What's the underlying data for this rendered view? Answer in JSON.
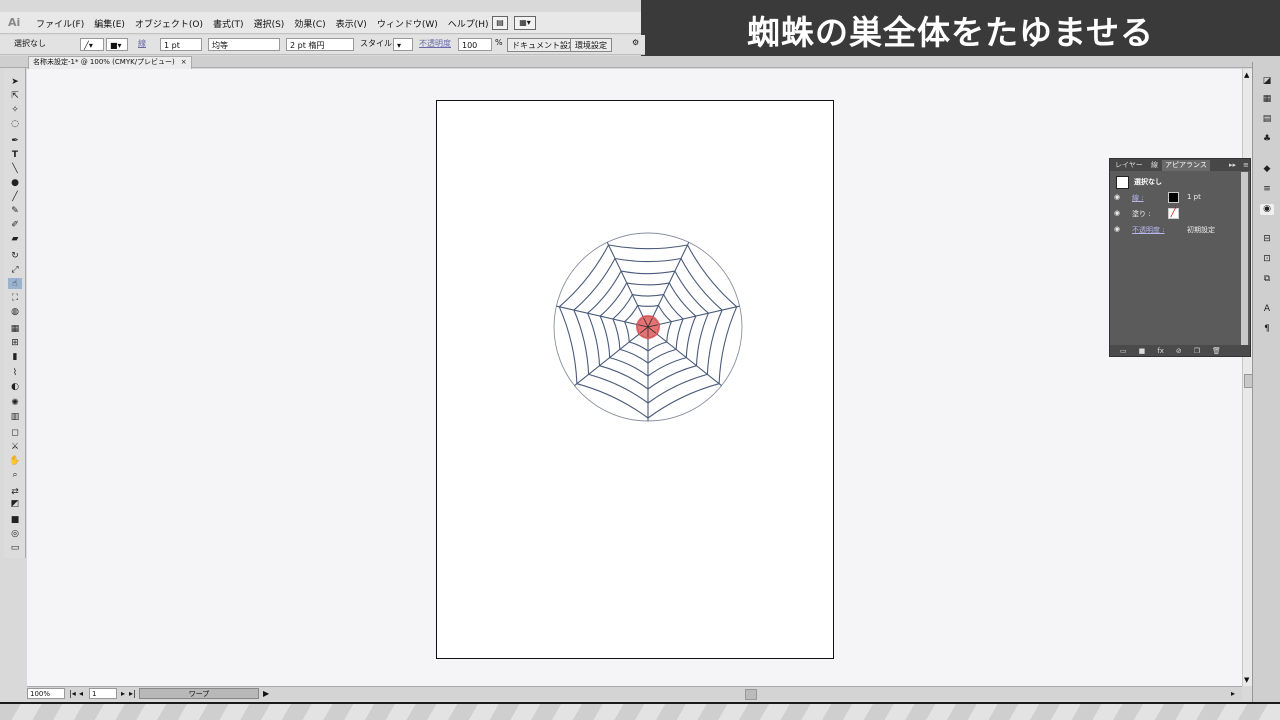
{
  "banner": {
    "title": "蜘蛛の巣全体をたゆませる"
  },
  "app": {
    "logo": "Ai"
  },
  "menu": {
    "items": [
      "ファイル(F)",
      "編集(E)",
      "オブジェクト(O)",
      "書式(T)",
      "選択(S)",
      "効果(C)",
      "表示(V)",
      "ウィンドウ(W)",
      "ヘルプ(H)"
    ],
    "extra_icon": "br-icon",
    "arrange_icon": "arrange-documents-icon"
  },
  "control": {
    "selection": "選択なし",
    "stroke_label": "線",
    "stroke_weight": "1 pt",
    "profile": "均等",
    "brush": "2 pt 楕円",
    "style_label": "スタイル",
    "opacity_label": "不透明度",
    "opacity": "100",
    "opacity_unit": "%",
    "doc_setup": "ドキュメント設定",
    "prefs": "環境設定"
  },
  "doc_tab": {
    "label": "名称未設定-1* @ 100% (CMYK/プレビュー)",
    "close": "×"
  },
  "tools": [
    "selection-tool",
    "direct-selection-tool",
    "magic-wand-tool",
    "lasso-tool",
    "pen-tool",
    "type-tool",
    "line-tool",
    "ellipse-tool",
    "paintbrush-tool",
    "pencil-tool",
    "blob-brush-tool",
    "eraser-tool",
    "rotate-tool",
    "scale-tool",
    "warp-tool",
    "free-transform-tool",
    "shape-builder-tool",
    "perspective-tool",
    "mesh-tool",
    "gradient-tool",
    "eyedropper-tool",
    "blend-tool",
    "symbol-sprayer-tool",
    "graph-tool",
    "artboard-tool",
    "slice-tool",
    "hand-tool",
    "zoom-tool"
  ],
  "panel": {
    "tabs": [
      "レイヤー",
      "線",
      "アピアランス"
    ],
    "header": "選択なし",
    "rows": [
      {
        "label": "線 :",
        "value": "1 pt"
      },
      {
        "label": "塗り :",
        "value": ""
      },
      {
        "label": "不透明度 :",
        "value": "初期設定"
      }
    ]
  },
  "status": {
    "zoom": "100%",
    "page": "1",
    "tool": "ワープ"
  },
  "colors": {
    "web_stroke": "#4a5a7a",
    "center_fill": "#e25a5a",
    "banner_bg": "#3a3a3a",
    "panel_bg": "#5b5b5b"
  }
}
